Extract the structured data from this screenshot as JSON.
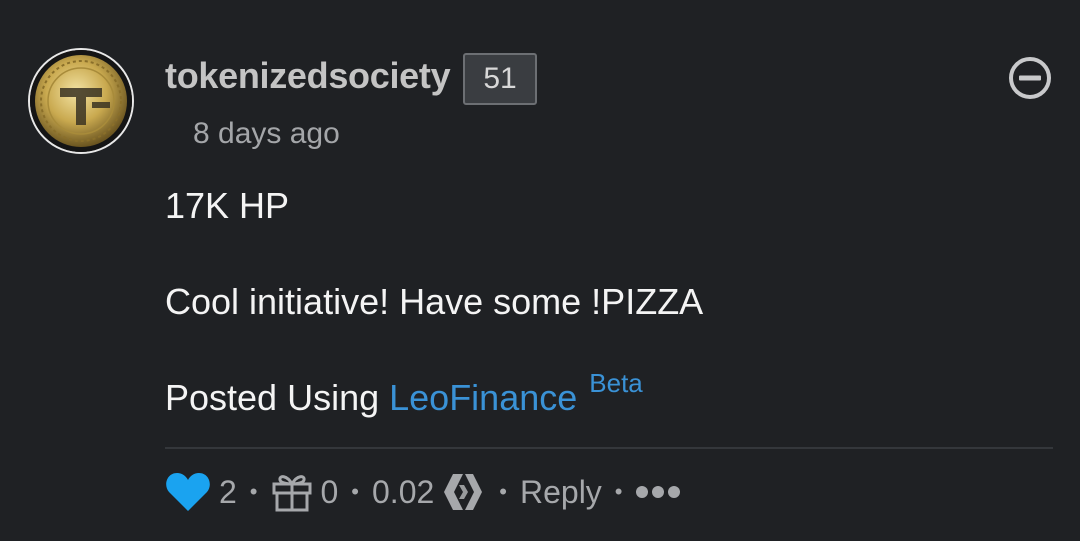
{
  "comment": {
    "author": "tokenizedsociety",
    "reputation": "51",
    "timestamp": "8 days ago",
    "body": {
      "line1": "17K HP",
      "line2": "Cool initiative! Have some !PIZZA",
      "line3_prefix": "Posted Using ",
      "line3_link": "LeoFinance",
      "line3_sup": "Beta"
    },
    "footer": {
      "votes": "2",
      "tips": "0",
      "payout": "0.02",
      "reply_label": "Reply",
      "separator": "•"
    }
  },
  "icons": {
    "avatar": "coin-logo",
    "collapse": "minus-circle-icon",
    "vote": "heart-icon",
    "tip": "gift-icon",
    "currency": "hive-icon",
    "more": "ellipsis-icon"
  },
  "colors": {
    "background": "#1f2124",
    "link": "#3a92d6",
    "heart": "#1aa3f0",
    "muted": "#a6a8ab"
  }
}
